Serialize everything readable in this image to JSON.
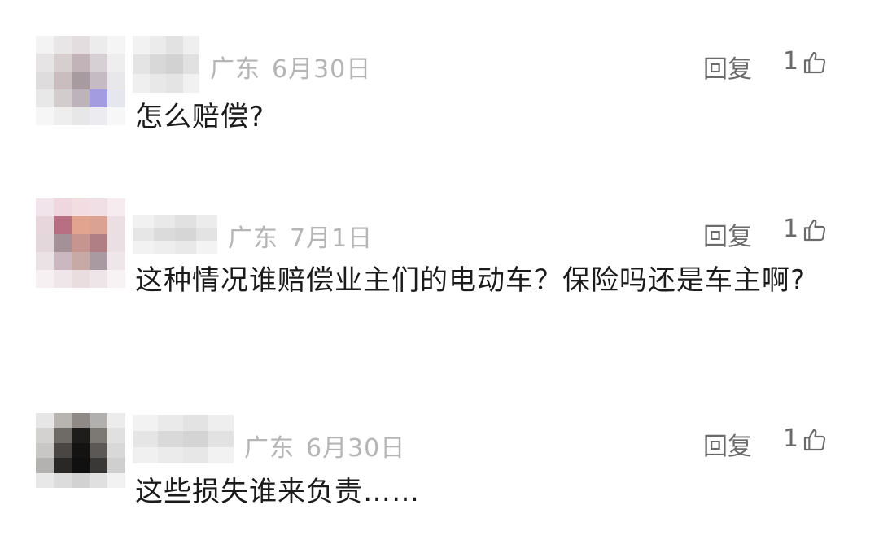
{
  "comments": [
    {
      "location": "广东",
      "date": "6月30日",
      "reply_label": "回复",
      "likes": "1",
      "text": "怎么赔偿?"
    },
    {
      "location": "广东",
      "date": "7月1日",
      "reply_label": "回复",
      "likes": "1",
      "text": "这种情况谁赔偿业主们的电动车？保险吗还是车主啊?"
    },
    {
      "location": "广东",
      "date": "6月30日",
      "reply_label": "回复",
      "likes": "1",
      "text": "这些损失谁来负责……"
    }
  ],
  "colors": {
    "meta": "#b5b5b5",
    "action": "#6a6a6a",
    "text": "#1b1b1b"
  },
  "icons": {
    "like": "thumbs-up-icon"
  }
}
